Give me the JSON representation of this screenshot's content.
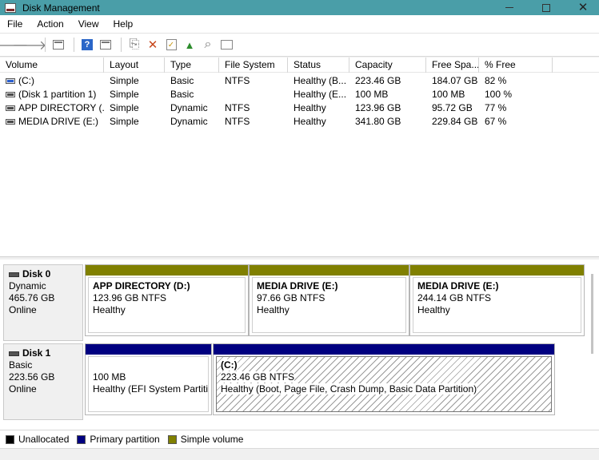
{
  "window": {
    "title": "Disk Management",
    "minimize": "—",
    "maximize": "☐",
    "close": "✕"
  },
  "menu": [
    "File",
    "Action",
    "View",
    "Help"
  ],
  "toolbar": [
    "back-icon",
    "forward-icon",
    "console-tree-icon",
    "help-icon",
    "show-pane-icon",
    "connect-icon",
    "delete-icon",
    "check-icon",
    "up-folder-icon",
    "search-icon",
    "properties-icon"
  ],
  "columns": [
    "Volume",
    "Layout",
    "Type",
    "File System",
    "Status",
    "Capacity",
    "Free Spa...",
    "% Free"
  ],
  "volumes": [
    {
      "volume": "(C:)",
      "layout": "Simple",
      "type": "Basic",
      "fs": "NTFS",
      "status": "Healthy (B...",
      "capacity": "223.46 GB",
      "free": "184.07 GB",
      "pct": "82 %",
      "icon": "blue"
    },
    {
      "volume": "(Disk 1 partition 1)",
      "layout": "Simple",
      "type": "Basic",
      "fs": "",
      "status": "Healthy (E...",
      "capacity": "100 MB",
      "free": "100 MB",
      "pct": "100 %",
      "icon": "gray"
    },
    {
      "volume": "APP DIRECTORY (...",
      "layout": "Simple",
      "type": "Dynamic",
      "fs": "NTFS",
      "status": "Healthy",
      "capacity": "123.96 GB",
      "free": "95.72 GB",
      "pct": "77 %",
      "icon": "gray"
    },
    {
      "volume": "MEDIA DRIVE (E:)",
      "layout": "Simple",
      "type": "Dynamic",
      "fs": "NTFS",
      "status": "Healthy",
      "capacity": "341.80 GB",
      "free": "229.84 GB",
      "pct": "67 %",
      "icon": "gray"
    }
  ],
  "disks": [
    {
      "name": "Disk 0",
      "type": "Dynamic",
      "size": "465.76 GB",
      "state": "Online",
      "partitions": [
        {
          "name": "APP DIRECTORY  (D:)",
          "detail": "123.96 GB NTFS",
          "status": "Healthy",
          "bar": "#808000"
        },
        {
          "name": "MEDIA DRIVE  (E:)",
          "detail": "97.66 GB NTFS",
          "status": "Healthy",
          "bar": "#808000"
        },
        {
          "name": "MEDIA DRIVE  (E:)",
          "detail": "244.14 GB NTFS",
          "status": "Healthy",
          "bar": "#808000"
        }
      ]
    },
    {
      "name": "Disk 1",
      "type": "Basic",
      "size": "223.56 GB",
      "state": "Online",
      "partitions": [
        {
          "name": "",
          "detail": "100 MB",
          "status": "Healthy (EFI System Partitio",
          "bar": "#000080"
        },
        {
          "name": "(C:)",
          "detail": "223.46 GB NTFS",
          "status": "Healthy (Boot, Page File, Crash Dump, Basic Data Partition)",
          "bar": "#000080"
        }
      ]
    }
  ],
  "legend": [
    {
      "label": "Unallocated",
      "color": "#000000"
    },
    {
      "label": "Primary partition",
      "color": "#000080"
    },
    {
      "label": "Simple volume",
      "color": "#808000"
    }
  ]
}
